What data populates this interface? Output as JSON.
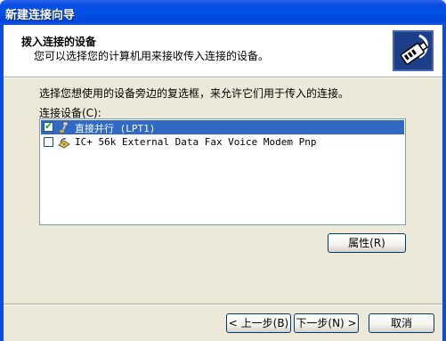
{
  "window": {
    "title": "新建连接向导"
  },
  "header": {
    "title": "拨入连接的设备",
    "subtitle": "您可以选择您的计算机用来接收传入连接的设备。",
    "icon": "phone-connector-icon"
  },
  "instructions": "选择您想使用的设备旁边的复选框，来允许它们用于传入的连接。",
  "device_list": {
    "label": "连接设备(C):",
    "items": [
      {
        "label": "直接并行 (LPT1)",
        "checked": true,
        "selected": true,
        "icon": "parallel-cable-icon"
      },
      {
        "label": "IC+ 56k External Data Fax Voice Modem Pnp",
        "checked": false,
        "selected": false,
        "icon": "modem-icon"
      }
    ]
  },
  "buttons": {
    "properties": "属性(R)",
    "back": "< 上一步(B)",
    "next": "下一步(N) >",
    "cancel": "取消"
  }
}
